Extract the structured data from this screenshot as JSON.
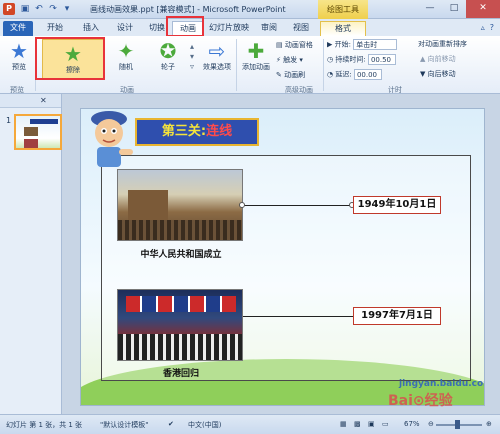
{
  "window": {
    "app_logo": "P",
    "title": "画线动画效果.ppt [兼容模式] - Microsoft PowerPoint",
    "context_tool": "绘图工具",
    "minimize": "—",
    "maximize": "□",
    "close": "✕"
  },
  "qat": {
    "save": "▣",
    "undo": "↶",
    "redo": "↷",
    "customize": "▾"
  },
  "tabs": [
    {
      "label": "文件"
    },
    {
      "label": "开始"
    },
    {
      "label": "插入"
    },
    {
      "label": "设计"
    },
    {
      "label": "切换"
    },
    {
      "label": "动画"
    },
    {
      "label": "幻灯片放映"
    },
    {
      "label": "审阅"
    },
    {
      "label": "视图"
    },
    {
      "label": "格式"
    }
  ],
  "ribbon": {
    "preview": {
      "label": "预览",
      "group": "预览"
    },
    "animations": [
      {
        "label": "擦除"
      },
      {
        "label": "随机"
      },
      {
        "label": "轮子"
      }
    ],
    "effect_options": "效果选项",
    "group_animation": "动画",
    "add_animation": "添加动画",
    "animation_pane": "动画窗格",
    "trigger": "触发",
    "animation_painter": "动画刷",
    "group_advanced": "高级动画",
    "start_label": "开始:",
    "start_value": "单击时",
    "duration_label": "持续时间:",
    "duration_value": "00.50",
    "delay_label": "延迟:",
    "delay_value": "00.00",
    "reorder_title": "对动画重新排序",
    "move_earlier": "向前移动",
    "move_later": "向后移动",
    "group_timing": "计时"
  },
  "left_panel": {
    "slide_number": "1"
  },
  "slide": {
    "title_prefix": "第三关:",
    "title_highlight": "连线",
    "caption1": "中华人民共和国成立",
    "caption2": "香港回归",
    "date1": "1949年10月1日",
    "date2": "1997年7月1日",
    "watermark": "jingyan.baidu.com",
    "watermark_brand": "Bai⊙经验"
  },
  "statusbar": {
    "slide_info": "幻灯片 第 1 张，共 1 张",
    "theme": "\"默认设计模板\"",
    "language": "中文(中国)",
    "zoom": "67%"
  }
}
